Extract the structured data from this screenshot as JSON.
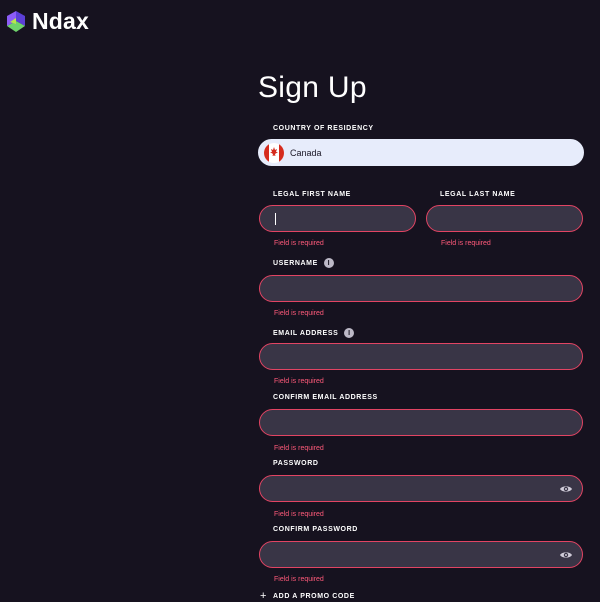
{
  "brand": {
    "name": "Ndax",
    "logo_icon": "ndax-logo-icon"
  },
  "page": {
    "title": "Sign Up"
  },
  "form": {
    "country": {
      "label": "COUNTRY OF RESIDENCY",
      "value": "Canada",
      "flag_icon": "canada-flag-icon"
    },
    "first_name": {
      "label": "LEGAL FIRST NAME",
      "value": "",
      "error": "Field is required"
    },
    "last_name": {
      "label": "LEGAL LAST NAME",
      "value": "",
      "error": "Field is required"
    },
    "username": {
      "label": "USERNAME",
      "value": "",
      "error": "Field is required",
      "info_icon": "info-icon"
    },
    "email": {
      "label": "EMAIL ADDRESS",
      "value": "",
      "error": "Field is required",
      "info_icon": "info-icon"
    },
    "confirm_email": {
      "label": "CONFIRM EMAIL ADDRESS",
      "value": "",
      "error": "Field is required"
    },
    "password": {
      "label": "PASSWORD",
      "value": "",
      "error": "Field is required",
      "toggle_icon": "eye-icon"
    },
    "confirm_password": {
      "label": "CONFIRM PASSWORD",
      "value": "",
      "error": "Field is required",
      "toggle_icon": "eye-icon"
    },
    "promo": {
      "label": "ADD A PROMO CODE",
      "icon": "plus-icon"
    }
  },
  "colors": {
    "background": "#16121f",
    "field_background": "#393546",
    "field_border_error": "#e24463",
    "error_text": "#ff5a7a",
    "country_field_background": "#e7ecfb"
  }
}
